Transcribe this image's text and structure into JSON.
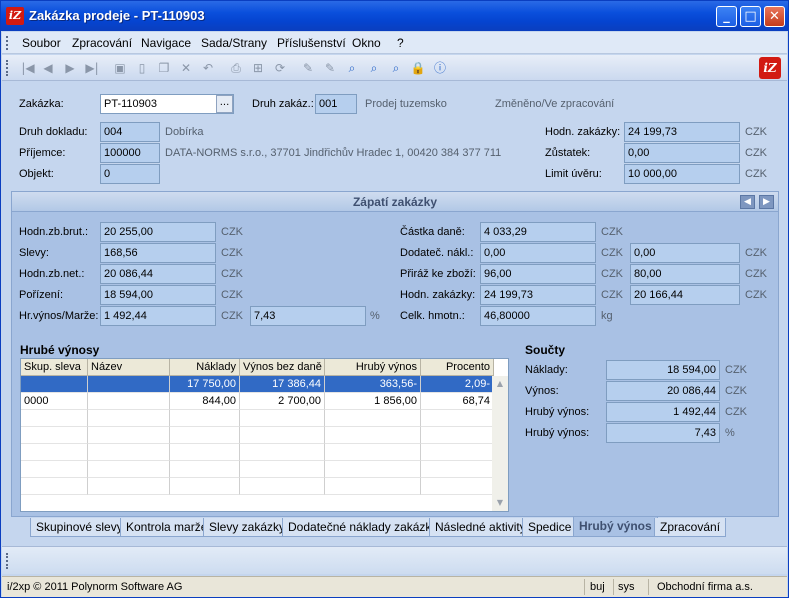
{
  "window": {
    "title": "Zakázka prodeje - PT-110903",
    "logo_text": "iZ",
    "min": "_",
    "max": "□",
    "close": "✕"
  },
  "menu": [
    "Soubor",
    "Zpracování",
    "Navigace",
    "Sada/Strany",
    "Příslušenství",
    "Okno",
    "?"
  ],
  "toolbar_icons": [
    "first-record-icon",
    "previous-record-icon",
    "next-record-icon",
    "last-record-icon",
    "save-icon",
    "new-icon",
    "copy-icon",
    "delete-icon",
    "undo-icon",
    "print-icon",
    "tree-icon",
    "refresh-icon",
    "edit-icon",
    "edit-alt-icon",
    "find-icon",
    "search-icon",
    "zoom-icon",
    "lock-icon",
    "info-icon"
  ],
  "header": {
    "zakazka_label": "Zakázka:",
    "zakazka_value": "PT-110903",
    "ellipsis": "...",
    "druh_zakaz_label": "Druh zakáz.:",
    "druh_zakaz_value": "001",
    "druh_zakaz_text": "Prodej tuzemsko",
    "status": "Změněno/Ve zpracování",
    "druh_dokladu_label": "Druh dokladu:",
    "druh_dokladu_value": "004",
    "druh_dokladu_text": "Dobírka",
    "prijemce_label": "Příjemce:",
    "prijemce_value": "100000",
    "prijemce_text": "DATA-NORMS s.r.o., 37701 Jindřichův Hradec 1, 00420 384 377 711",
    "objekt_label": "Objekt:",
    "objekt_value": "0",
    "hodn_zakazky_label": "Hodn. zakázky:",
    "hodn_zakazky_value": "24 199,73",
    "hodn_zakazky_cur": "CZK",
    "zustatek_label": "Zůstatek:",
    "zustatek_value": "0,00",
    "zustatek_cur": "CZK",
    "limit_label": "Limit úvěru:",
    "limit_value": "10 000,00",
    "limit_cur": "CZK"
  },
  "footer_section": {
    "title": "Zápatí zakázky",
    "hodn_zb_brut_label": "Hodn.zb.brut.:",
    "hodn_zb_brut_value": "20 255,00",
    "slevy_label": "Slevy:",
    "slevy_value": "168,56",
    "hodn_zb_net_label": "Hodn.zb.net.:",
    "hodn_zb_net_value": "20 086,44",
    "porizeni_label": "Pořízení:",
    "porizeni_value": "18 594,00",
    "hr_vynos_label": "Hr.výnos/Marže:",
    "hr_vynos_value": "1 492,44",
    "hr_vynos_pct": "7,43",
    "castka_dane_label": "Částka daně:",
    "castka_dane_value": "4 033,29",
    "dodatec_label": "Dodateč. nákl.:",
    "dodatec_value": "0,00",
    "dodatec_value2": "0,00",
    "priraz_label": "Přiráž ke zboží:",
    "priraz_value": "96,00",
    "priraz_value2": "80,00",
    "hodn_zakazky_label": "Hodn. zakázky:",
    "hodn_zakazky_value": "24 199,73",
    "hodn_zakazky_value2": "20 166,44",
    "celk_hmotn_label": "Celk. hmotn.:",
    "celk_hmotn_value": "46,80000",
    "celk_hmotn_unit": "kg",
    "cur": "CZK",
    "pct": "%"
  },
  "hrube_vynosy": {
    "title": "Hrubé výnosy",
    "columns": [
      "Skup. sleva",
      "Název",
      "Náklady",
      "Výnos bez daně",
      "Hrubý výnos",
      "Procento"
    ],
    "rows": [
      [
        "",
        "",
        "17 750,00",
        "17 386,44",
        "363,56-",
        "2,09-"
      ],
      [
        "0000",
        "",
        "844,00",
        "2 700,00",
        "1 856,00",
        "68,74"
      ]
    ]
  },
  "soucty": {
    "title": "Součty",
    "naklady_label": "Náklady:",
    "naklady_value": "18 594,00",
    "vynos_label": "Výnos:",
    "vynos_value": "20 086,44",
    "hruby_label": "Hrubý výnos:",
    "hruby_value": "1 492,44",
    "hruby_pct_label": "Hrubý výnos:",
    "hruby_pct_value": "7,43",
    "cur": "CZK",
    "pct": "%"
  },
  "tabs": [
    "Skupinové slevy",
    "Kontrola marže",
    "Slevy zakázky",
    "Dodatečné náklady zakázky",
    "Následné aktivity",
    "Spedice",
    "Hrubý výnos",
    "Zpracování"
  ],
  "status": {
    "copyright": "i/2xp © 2011 Polynorm Software AG",
    "user": "buj",
    "db": "sys",
    "company": "Obchodní firma a.s."
  }
}
